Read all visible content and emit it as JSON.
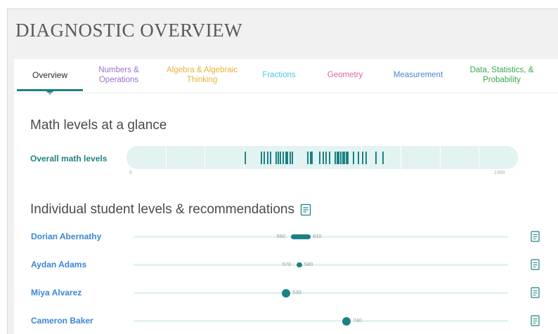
{
  "page": {
    "title": "DIAGNOSTIC OVERVIEW"
  },
  "colors": {
    "teal": "#1b8283",
    "track": "#e3f3f2",
    "link": "#3a86d6"
  },
  "tabs": [
    {
      "label": "Overview",
      "color": "#2b2b2b",
      "active": true
    },
    {
      "label": "Numbers & Operations",
      "color": "#9b72cf",
      "active": false
    },
    {
      "label": "Algebra & Algebraic Thinking",
      "color": "#e8b43a",
      "active": false
    },
    {
      "label": "Fractions",
      "color": "#52c7e6",
      "active": false
    },
    {
      "label": "Geometry",
      "color": "#e05fa6",
      "active": false
    },
    {
      "label": "Measurement",
      "color": "#4a86d4",
      "active": false
    },
    {
      "label": "Data, Statistics, & Probability",
      "color": "#3aa84e",
      "active": false
    }
  ],
  "math_levels": {
    "heading": "Math levels at a glance",
    "row_label": "Overall math levels",
    "axis_min": 0,
    "axis_max": 1300,
    "axis_min_label": "0",
    "axis_max_label": "1300",
    "student_levels": [
      392,
      445,
      455,
      466,
      476,
      494,
      501,
      508,
      519,
      527,
      533,
      542,
      548,
      600,
      608,
      614,
      640,
      652,
      660,
      672,
      690,
      697,
      703,
      710,
      716,
      722,
      728,
      734,
      752,
      768,
      782,
      794,
      826,
      850
    ]
  },
  "individual": {
    "heading": "Individual student levels & recommendations",
    "axis_min": 0,
    "axis_max": 1300,
    "students": [
      {
        "name": "Dorian Abernathy",
        "low": 550,
        "high": 610,
        "low_label": "550",
        "high_label": "610"
      },
      {
        "name": "Aydan Adams",
        "low": 570,
        "high": 580,
        "low_label": "570",
        "high_label": "580"
      },
      {
        "name": "Miya Alvarez",
        "low": 530,
        "high": 530,
        "low_label": "530",
        "high_label": ""
      },
      {
        "name": "Cameron Baker",
        "low": 740,
        "high": 740,
        "low_label": "740",
        "high_label": ""
      }
    ]
  },
  "icons": {
    "report": "document-icon"
  }
}
